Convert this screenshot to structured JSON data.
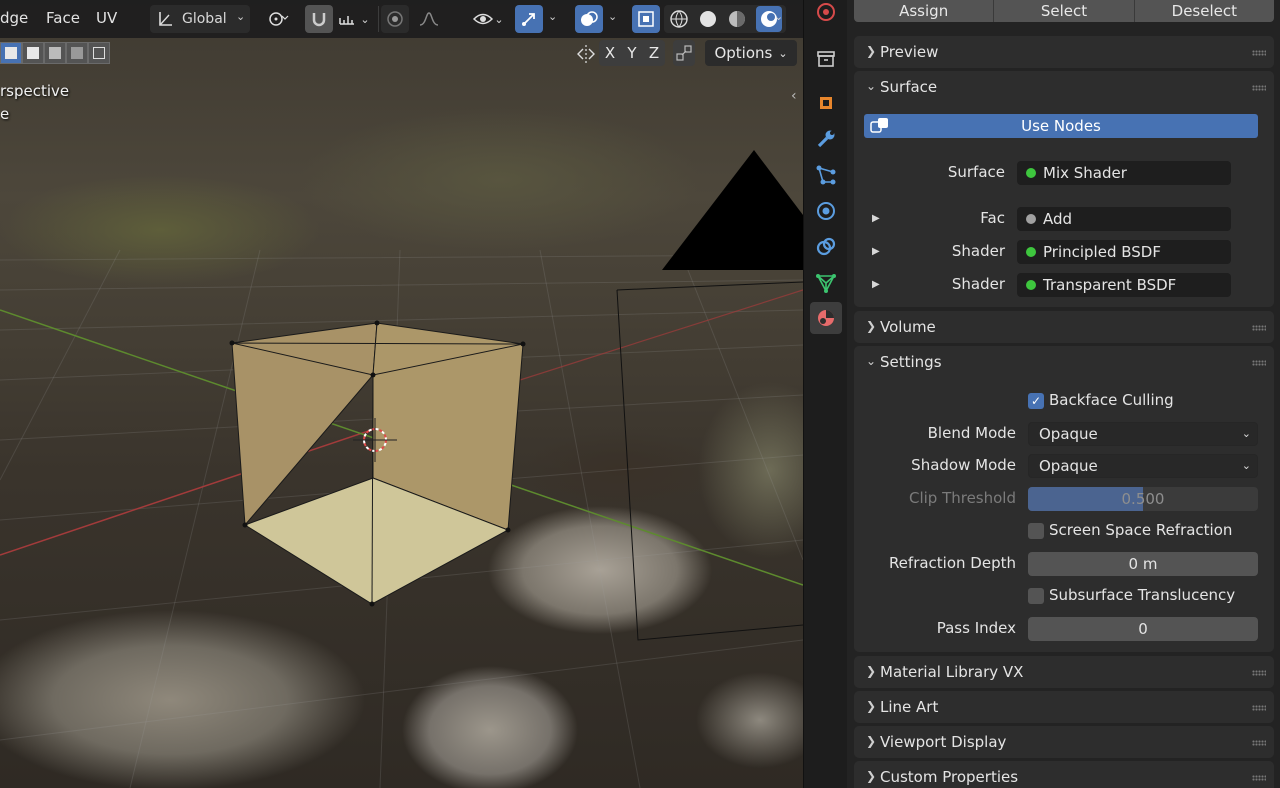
{
  "viewport": {
    "header": {
      "menu_edge": "dge",
      "menu_face": "Face",
      "menu_uv": "UV",
      "transform_orientation": "Global",
      "options_label": "Options",
      "axis_x": "X",
      "axis_y": "Y",
      "axis_z": "Z"
    },
    "overlay_line1": "rspective",
    "overlay_line2": "e"
  },
  "tabs": [
    {
      "name": "scene-tab",
      "icon": "scene-icon",
      "active": false
    },
    {
      "name": "tool-tab",
      "icon": "tool-icon",
      "active": false
    },
    {
      "name": "object-tab",
      "icon": "object-icon",
      "active": false
    },
    {
      "name": "modifier-tab",
      "icon": "wrench-icon",
      "active": false
    },
    {
      "name": "particles-tab",
      "icon": "particles-icon",
      "active": false
    },
    {
      "name": "physics-tab",
      "icon": "physics-icon",
      "active": false
    },
    {
      "name": "constraints-tab",
      "icon": "constraints-icon",
      "active": false
    },
    {
      "name": "data-tab",
      "icon": "mesh-data-icon",
      "active": false
    },
    {
      "name": "material-tab",
      "icon": "material-icon",
      "active": true
    }
  ],
  "properties": {
    "top_buttons": {
      "assign": "Assign",
      "select": "Select",
      "deselect": "Deselect"
    },
    "panels": {
      "preview": "Preview",
      "surface": "Surface",
      "volume": "Volume",
      "settings": "Settings",
      "material_library": "Material Library VX",
      "line_art": "Line Art",
      "viewport_display": "Viewport Display",
      "custom_properties": "Custom Properties"
    },
    "surface": {
      "use_nodes": "Use Nodes",
      "surface_label": "Surface",
      "surface_value": "Mix Shader",
      "inputs": [
        {
          "label": "Fac",
          "value": "Add",
          "dot_color": "#a1a1a1"
        },
        {
          "label": "Shader",
          "value": "Principled BSDF",
          "dot_color": "#3ec63e"
        },
        {
          "label": "Shader",
          "value": "Transparent BSDF",
          "dot_color": "#3ec63e"
        }
      ],
      "surface_dot_color": "#3ec63e"
    },
    "settings": {
      "backface_culling": "Backface Culling",
      "backface_culling_checked": true,
      "blend_mode_label": "Blend Mode",
      "blend_mode_value": "Opaque",
      "shadow_mode_label": "Shadow Mode",
      "shadow_mode_value": "Opaque",
      "clip_threshold_label": "Clip Threshold",
      "clip_threshold_value": "0.500",
      "clip_threshold_fraction": 0.5,
      "screen_space_refraction": "Screen Space Refraction",
      "screen_space_refraction_checked": false,
      "refraction_depth_label": "Refraction Depth",
      "refraction_depth_value": "0 m",
      "subsurface_translucency": "Subsurface Translucency",
      "subsurface_translucency_checked": false,
      "pass_index_label": "Pass Index",
      "pass_index_value": "0"
    }
  },
  "colors": {
    "accent": "#4772b3",
    "panel_bg": "#2d2d2d",
    "editor_bg": "#232323",
    "cube_face": "#a89267"
  }
}
